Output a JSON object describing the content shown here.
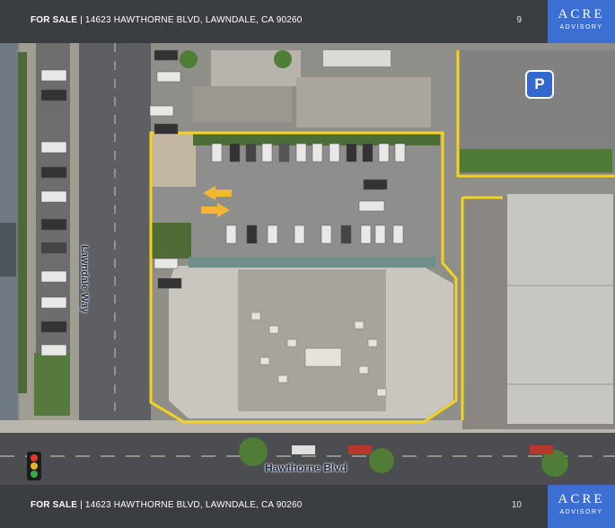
{
  "header": {
    "sale_label": "FOR SALE",
    "address": "| 14623 HAWTHORNE BLVD, LAWNDALE, CA 90260",
    "page_number": "9"
  },
  "footer": {
    "sale_label": "FOR SALE",
    "address": "| 14623 HAWTHORNE BLVD, LAWNDALE, CA 90260",
    "page_number": "10"
  },
  "logo": {
    "name": "ACRE",
    "subtitle": "ADVISORY"
  },
  "map": {
    "street_horizontal": "Hawthorne Blvd",
    "street_vertical": "Lawndale Way",
    "parking_marker": "P",
    "boundary_color": "#f5d21e",
    "arrow_color": "#f2b632"
  }
}
